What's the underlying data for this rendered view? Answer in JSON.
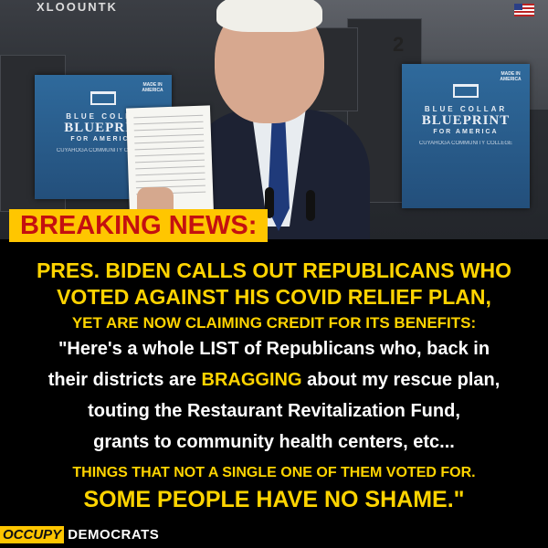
{
  "photo": {
    "top_cut_text": "XLOOUNTK",
    "sign_left": {
      "line1": "BLUE COLLA",
      "line2": "BLUEPRIN",
      "line3": "FOR AMERICA",
      "line4": "CUYAHOGA COMMUNITY COLLEGE",
      "badge": "MADE IN AMERICA"
    },
    "sign_right": {
      "line1": "BLUE COLLAR",
      "line2": "BLUEPRINT",
      "line3": "FOR AMERICA",
      "line4": "CUYAHOGA COMMUNITY COLLEGE",
      "badge": "MADE IN AMERICA"
    },
    "machine_number": "2"
  },
  "headline": {
    "breaking": "BREAKING NEWS:",
    "line1": "PRES. BIDEN CALLS OUT REPUBLICANS WHO",
    "line2": "VOTED  AGAINST HIS COVID RELIEF PLAN,",
    "line3": "YET ARE NOW CLAIMING CREDIT FOR ITS BENEFITS:"
  },
  "quote": {
    "q1": "\"Here's a whole LIST of Republicans who, back in",
    "q2_before": "their districts are ",
    "q2_highlight": "BRAGGING",
    "q2_after": " about my rescue plan,",
    "q3": "touting the Restaurant Revitalization Fund,",
    "q4": "grants to community health centers, etc...",
    "q5": "THINGS THAT NOT A SINGLE ONE OF THEM VOTED FOR.",
    "q6": "SOME PEOPLE HAVE NO SHAME.\""
  },
  "brand": {
    "occupy": "OCCUPY",
    "democrats": "DEMOCRATS"
  },
  "colors": {
    "yellow": "#ffd400",
    "banner": "#ffc600",
    "red": "#c41010"
  }
}
